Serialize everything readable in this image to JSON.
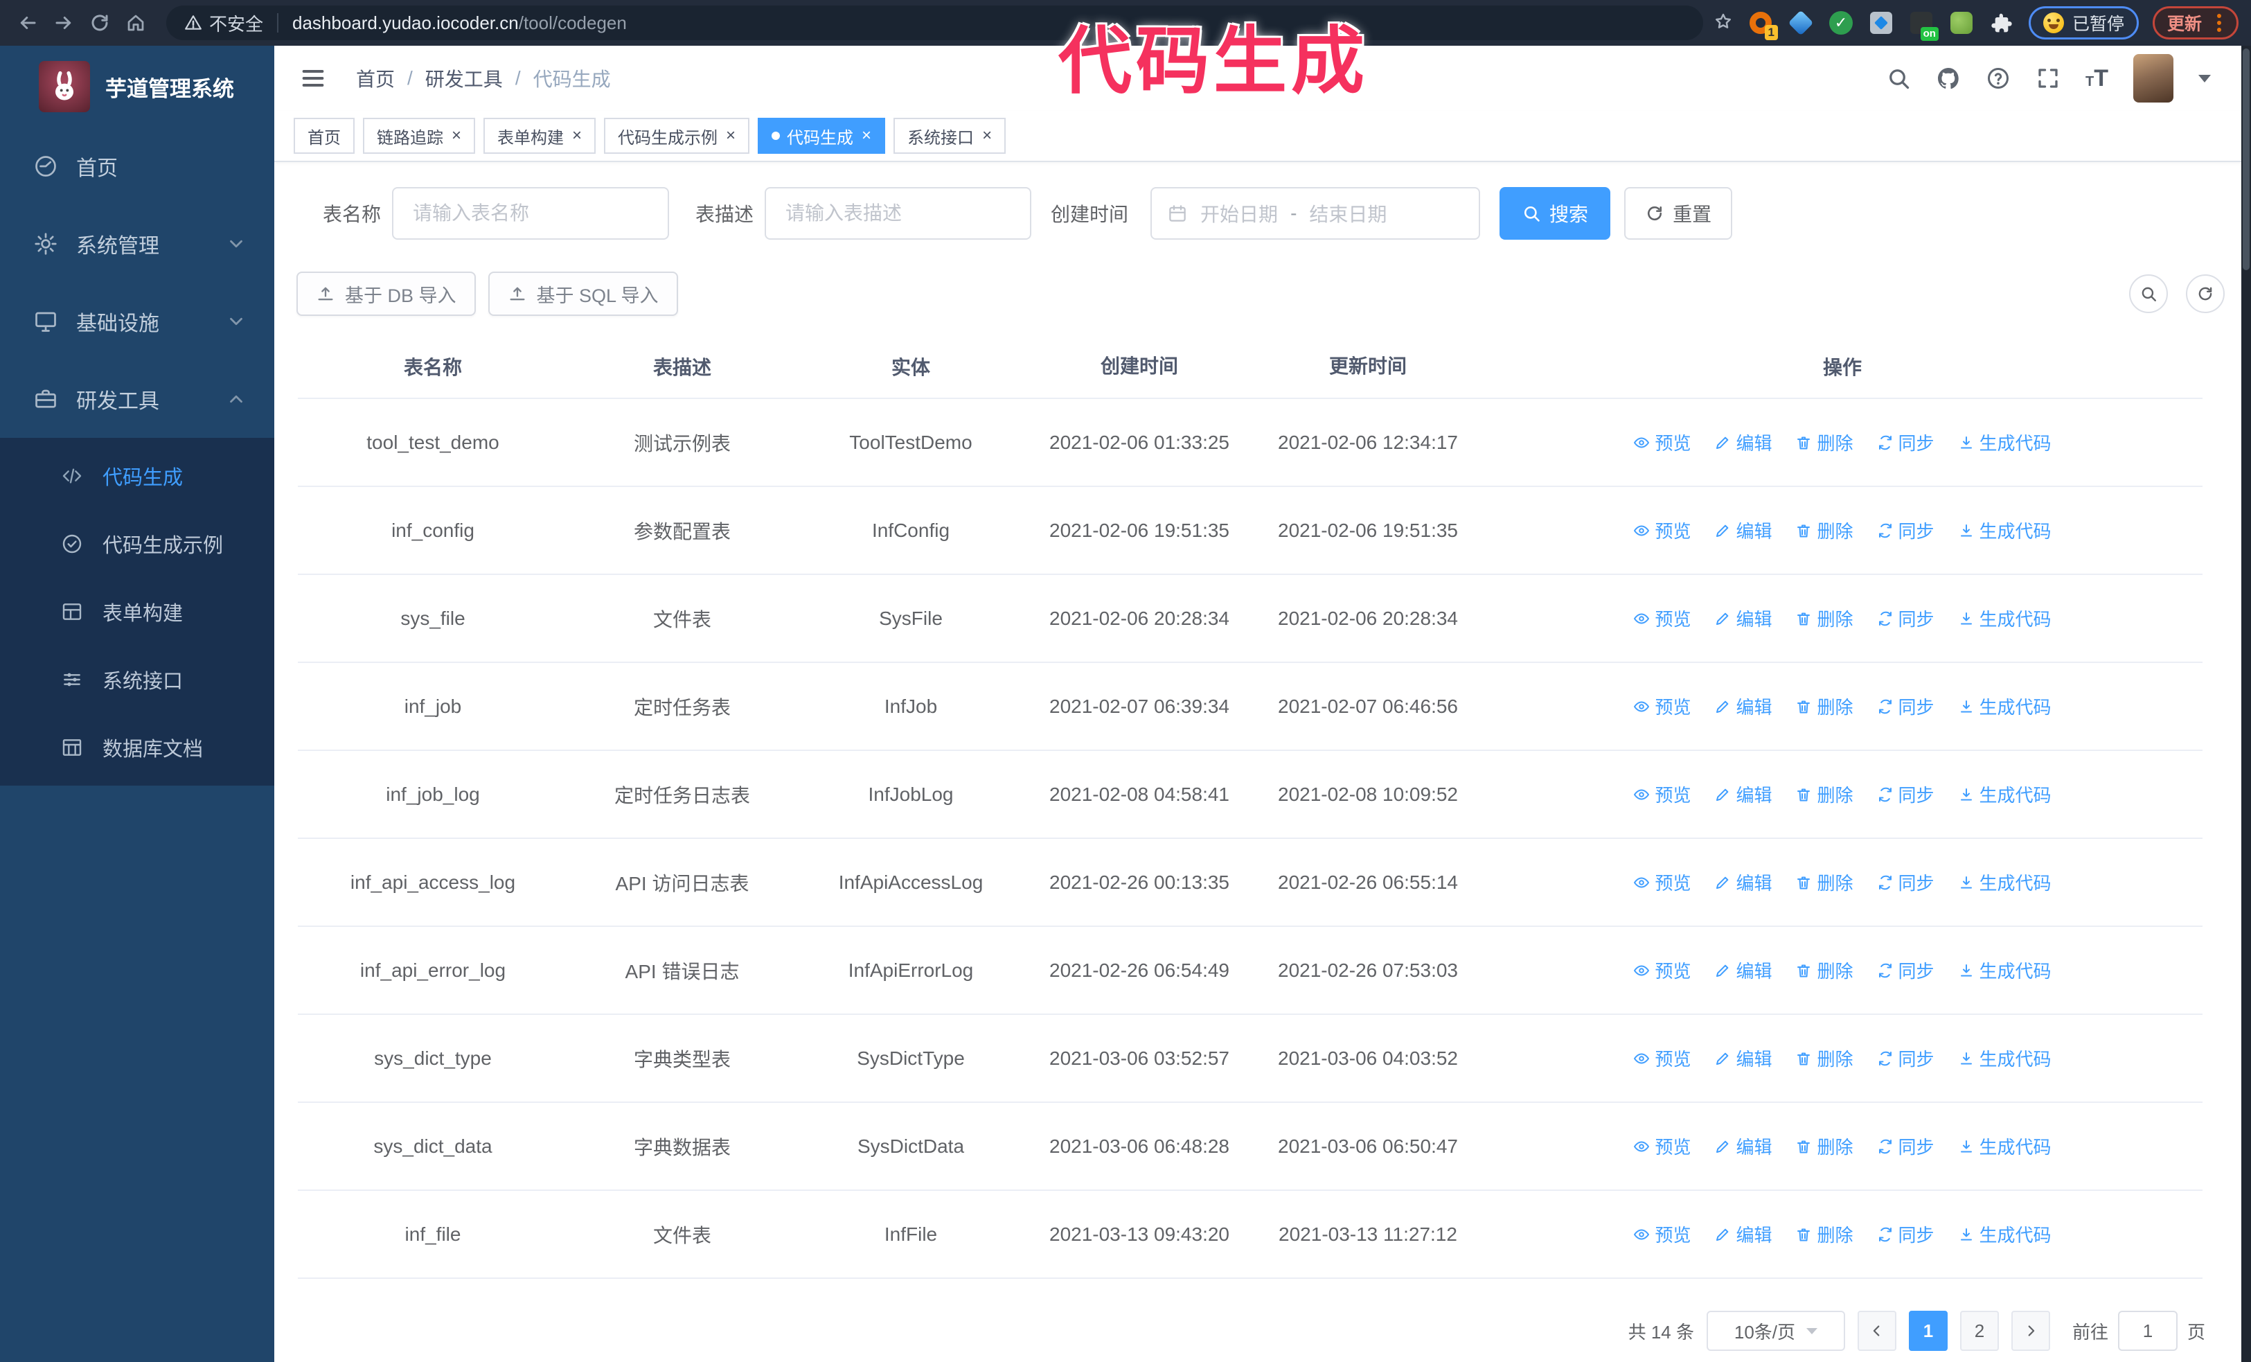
{
  "browser": {
    "security_label": "不安全",
    "url_host": "dashboard.yudao.iocoder.cn",
    "url_path": "/tool/codegen",
    "extension_badge_count": "1",
    "extension_badge_on": "on",
    "paused_badge": "已暂停",
    "update_label": "更新"
  },
  "overlay": {
    "title": "代码生成"
  },
  "sidebar": {
    "app_title": "芋道管理系统",
    "items": [
      {
        "label": "首页"
      },
      {
        "label": "系统管理"
      },
      {
        "label": "基础设施"
      },
      {
        "label": "研发工具"
      }
    ],
    "subitems": [
      {
        "label": "代码生成"
      },
      {
        "label": "代码生成示例"
      },
      {
        "label": "表单构建"
      },
      {
        "label": "系统接口"
      },
      {
        "label": "数据库文档"
      }
    ]
  },
  "breadcrumb": [
    "首页",
    "研发工具",
    "代码生成"
  ],
  "tabs": [
    {
      "label": "首页"
    },
    {
      "label": "链路追踪"
    },
    {
      "label": "表单构建"
    },
    {
      "label": "代码生成示例"
    },
    {
      "label": "代码生成"
    },
    {
      "label": "系统接口"
    }
  ],
  "filters": {
    "name_label": "表名称",
    "name_placeholder": "请输入表名称",
    "desc_label": "表描述",
    "desc_placeholder": "请输入表描述",
    "time_label": "创建时间",
    "start_placeholder": "开始日期",
    "separator": "-",
    "end_placeholder": "结束日期",
    "search_label": "搜索",
    "reset_label": "重置"
  },
  "toolbar": {
    "db_import_label": "基于 DB 导入",
    "sql_import_label": "基于 SQL 导入"
  },
  "table": {
    "headers": [
      "表名称",
      "表描述",
      "实体",
      "创建时间",
      "更新时间",
      "操作"
    ],
    "actions": [
      "预览",
      "编辑",
      "删除",
      "同步",
      "生成代码"
    ],
    "rows": [
      {
        "name": "tool_test_demo",
        "desc": "测试示例表",
        "entity": "ToolTestDemo",
        "created": "2021-02-06 01:33:25",
        "updated": "2021-02-06 12:34:17"
      },
      {
        "name": "inf_config",
        "desc": "参数配置表",
        "entity": "InfConfig",
        "created": "2021-02-06 19:51:35",
        "updated": "2021-02-06 19:51:35"
      },
      {
        "name": "sys_file",
        "desc": "文件表",
        "entity": "SysFile",
        "created": "2021-02-06 20:28:34",
        "updated": "2021-02-06 20:28:34"
      },
      {
        "name": "inf_job",
        "desc": "定时任务表",
        "entity": "InfJob",
        "created": "2021-02-07 06:39:34",
        "updated": "2021-02-07 06:46:56"
      },
      {
        "name": "inf_job_log",
        "desc": "定时任务日志表",
        "entity": "InfJobLog",
        "created": "2021-02-08 04:58:41",
        "updated": "2021-02-08 10:09:52"
      },
      {
        "name": "inf_api_access_log",
        "desc": "API 访问日志表",
        "entity": "InfApiAccessLog",
        "created": "2021-02-26 00:13:35",
        "updated": "2021-02-26 06:55:14"
      },
      {
        "name": "inf_api_error_log",
        "desc": "API 错误日志",
        "entity": "InfApiErrorLog",
        "created": "2021-02-26 06:54:49",
        "updated": "2021-02-26 07:53:03"
      },
      {
        "name": "sys_dict_type",
        "desc": "字典类型表",
        "entity": "SysDictType",
        "created": "2021-03-06 03:52:57",
        "updated": "2021-03-06 04:03:52"
      },
      {
        "name": "sys_dict_data",
        "desc": "字典数据表",
        "entity": "SysDictData",
        "created": "2021-03-06 06:48:28",
        "updated": "2021-03-06 06:50:47"
      },
      {
        "name": "inf_file",
        "desc": "文件表",
        "entity": "InfFile",
        "created": "2021-03-13 09:43:20",
        "updated": "2021-03-13 11:27:12"
      }
    ]
  },
  "pagination": {
    "total": "共 14 条",
    "page_size": "10条/页",
    "pages": [
      "1",
      "2"
    ],
    "goto_label": "前往",
    "goto_value": "1",
    "page_suffix": "页"
  },
  "colors": {
    "accent": "#409eff",
    "overlay_pink": "#f5315e",
    "sidebar_bg": "#20456a",
    "sidebar_submenu_bg": "#19304f",
    "chrome_bg": "#232c3b",
    "update_chip": "#c4463a",
    "paused_chip_border": "#4e8cf5"
  }
}
